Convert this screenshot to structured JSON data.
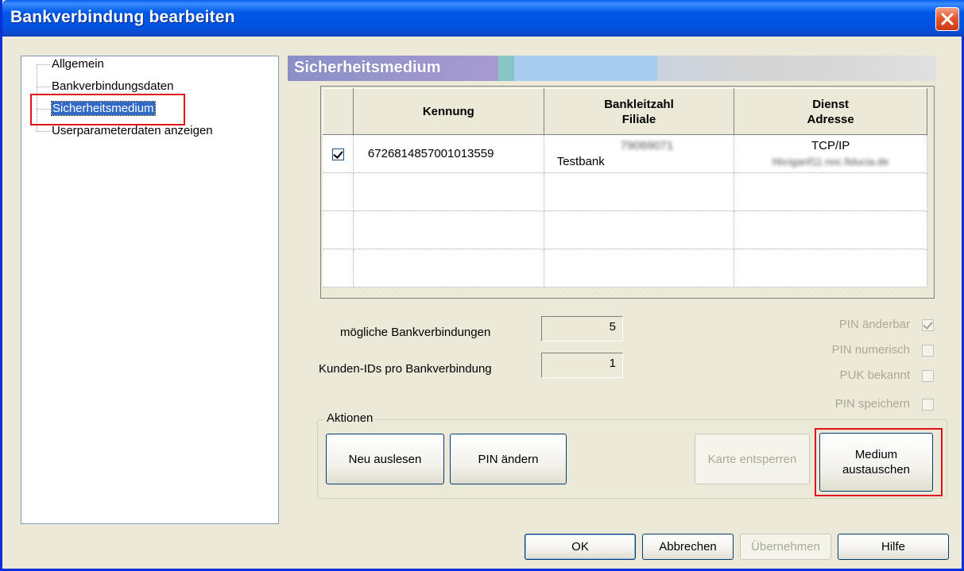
{
  "window": {
    "title": "Bankverbindung bearbeiten"
  },
  "tree": {
    "items": [
      {
        "label": "Allgemein"
      },
      {
        "label": "Bankverbindungsdaten"
      },
      {
        "label": "Sicherheitsmedium"
      },
      {
        "label": "Userparameterdaten anzeigen"
      }
    ]
  },
  "section": {
    "title": "Sicherheitsmedium"
  },
  "table": {
    "headers": {
      "kennung": "Kennung",
      "blz_line1": "Bankleitzahl",
      "blz_line2": "Filiale",
      "dienst_line1": "Dienst",
      "dienst_line2": "Adresse"
    },
    "rows": [
      {
        "checked": true,
        "kennung": "6726814857001013559",
        "blz": "79069071",
        "filiale": "Testbank",
        "dienst": "TCP/IP",
        "adresse": "hbciganf11.noc.fiducia.de"
      }
    ]
  },
  "info": {
    "bankverbindungen_label": "mögliche Bankverbindungen",
    "bankverbindungen_value": "5",
    "kunden_ids_label": "Kunden-IDs pro Bankverbindung",
    "kunden_ids_value": "1"
  },
  "options": {
    "pin_aenderbar": {
      "label": "PIN änderbar",
      "checked": true
    },
    "pin_numerisch": {
      "label": "PIN numerisch",
      "checked": false
    },
    "puk_bekannt": {
      "label": "PUK bekannt",
      "checked": false
    },
    "pin_speichern": {
      "label": "PIN speichern",
      "checked": false
    }
  },
  "actions": {
    "legend": "Aktionen",
    "neu_auslesen": "Neu auslesen",
    "pin_aendern": "PIN ändern",
    "karte_entsperren": "Karte entsperren",
    "medium_line1": "Medium",
    "medium_line2": "austauschen"
  },
  "footer": {
    "ok": "OK",
    "abbrechen": "Abbrechen",
    "uebernehmen": "Übernehmen",
    "hilfe": "Hilfe"
  },
  "colors": {
    "titlebar": "#0054e3",
    "highlight": "#e1131a",
    "selection": "#316ac5"
  }
}
